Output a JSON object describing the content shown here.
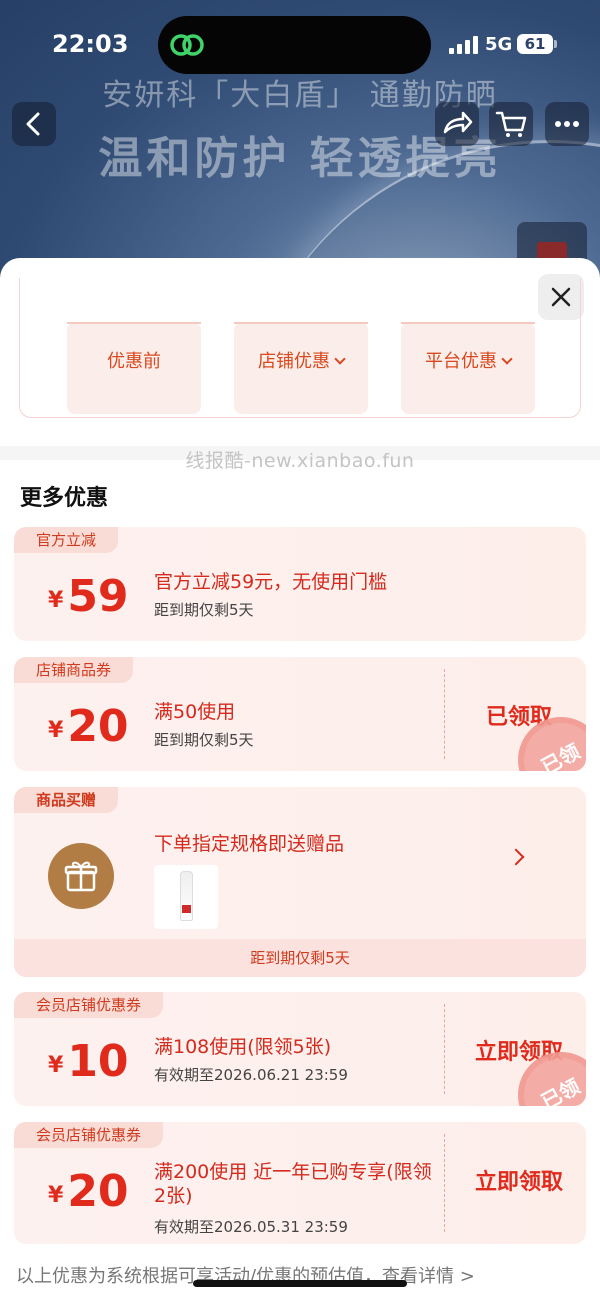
{
  "status_bar": {
    "time": "22:03",
    "network": "5G",
    "battery": "61"
  },
  "banner": {
    "line1": "安妍科「大白盾」 通勤防晒",
    "line2": "温和防护 轻透提亮"
  },
  "calculator": {
    "cells": [
      {
        "label": "优惠前",
        "has_dropdown": false
      },
      {
        "label": "店铺优惠",
        "has_dropdown": true
      },
      {
        "label": "平台优惠",
        "has_dropdown": true
      }
    ]
  },
  "watermark": "线报酷-new.xianbao.fun",
  "section_title": "更多优惠",
  "coupons": [
    {
      "tag": "官方立减",
      "currency": "¥",
      "amount": "59",
      "title": "官方立减59元，无使用门槛",
      "subtitle": "距到期仅剩5天"
    },
    {
      "tag": "店铺商品券",
      "currency": "¥",
      "amount": "20",
      "title": "满50使用",
      "subtitle": "距到期仅剩5天",
      "action": "已领取",
      "stamp": "已领"
    },
    {
      "tag": "商品买赠",
      "title": "下单指定规格即送赠品",
      "footer": "距到期仅剩5天"
    },
    {
      "tag": "会员店铺优惠券",
      "currency": "¥",
      "amount": "10",
      "title": "满108使用(限领5张)",
      "subtitle": "有效期至2026.06.21 23:59",
      "action": "立即领取",
      "stamp": "已领"
    },
    {
      "tag": "会员店铺优惠券",
      "currency": "¥",
      "amount": "20",
      "title": "满200使用 近一年已购专享(限领2张)",
      "subtitle": "有效期至2026.05.31 23:59",
      "action": "立即领取"
    }
  ],
  "footer_note": "以上优惠为系统根据可享活动/优惠的预估值，查看详情 >",
  "icons": {
    "back": "chevron-left-icon",
    "share": "share-icon",
    "cart": "cart-icon",
    "more": "more-icon",
    "close": "close-icon",
    "gift": "gift-icon"
  },
  "colors": {
    "accent": "#e02a1c",
    "card_bg": "#fdf0ed",
    "tag_bg": "#f9dcd6",
    "gift_circle": "#b27d45"
  }
}
